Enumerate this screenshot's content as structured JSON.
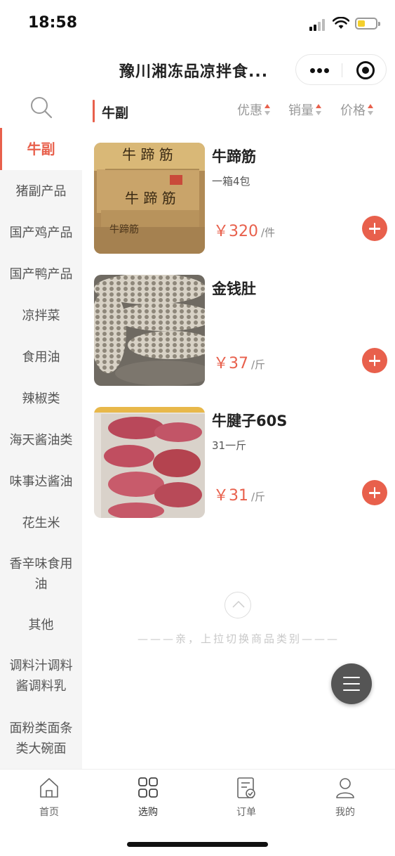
{
  "status_bar": {
    "time": "18:58"
  },
  "nav": {
    "title": "豫川湘冻品凉拌食..."
  },
  "sidebar": {
    "categories": [
      {
        "label": "牛副",
        "active": true
      },
      {
        "label": "猪副产品"
      },
      {
        "label": "国产鸡产品"
      },
      {
        "label": "国产鸭产品"
      },
      {
        "label": "凉拌菜"
      },
      {
        "label": "食用油"
      },
      {
        "label": "辣椒类"
      },
      {
        "label": "海天酱油类"
      },
      {
        "label": "味事达酱油"
      },
      {
        "label": "花生米"
      },
      {
        "label": "香辛味食用油"
      },
      {
        "label": "其他"
      },
      {
        "label": "调料汁调料酱调料乳"
      },
      {
        "label": "面粉类面条类大碗面"
      }
    ]
  },
  "content": {
    "section_title": "牛副",
    "sort": {
      "discount": "优惠",
      "sales": "销量",
      "price": "价格"
    },
    "products": [
      {
        "name": "牛蹄筋",
        "spec": "一箱4包",
        "price": "￥320",
        "unit": "/件",
        "image": "box-of-beef-tendon"
      },
      {
        "name": "金钱肚",
        "spec": "",
        "price": "￥37",
        "unit": "/斤",
        "image": "beef-tripe"
      },
      {
        "name": "牛腱子60S",
        "spec": "31一斤",
        "price": "￥31",
        "unit": "/斤",
        "image": "beef-shank"
      }
    ],
    "pull_hint": "———亲，上拉切换商品类别———"
  },
  "tabbar": {
    "home": "首页",
    "shop": "选购",
    "orders": "订单",
    "mine": "我的",
    "active": "shop"
  },
  "colors": {
    "accent": "#e8604c",
    "fab": "#555555"
  }
}
